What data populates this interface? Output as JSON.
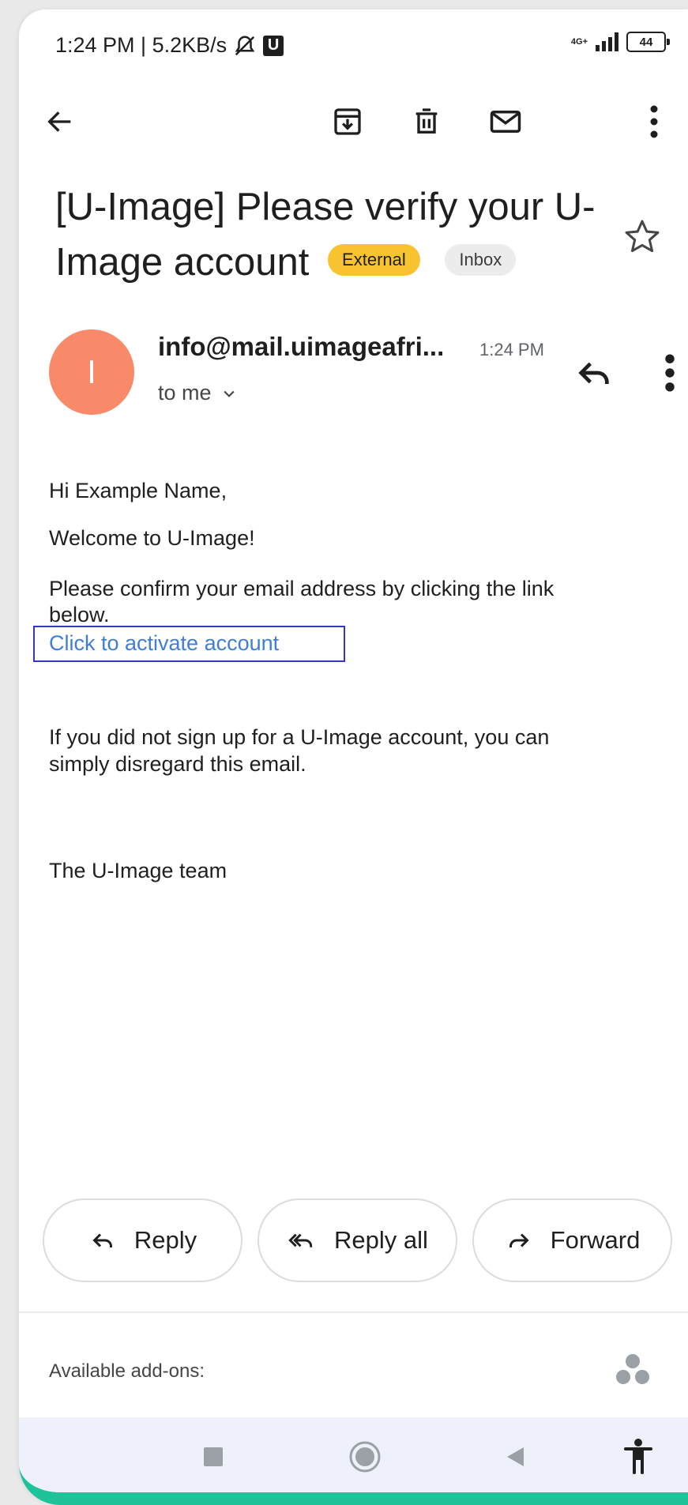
{
  "status_bar": {
    "time_speed": "1:24 PM | 5.2KB/s",
    "network": "4G+",
    "battery": "44"
  },
  "toolbar": {
    "back": "arrow-left-icon",
    "archive": "archive-icon",
    "delete": "trash-icon",
    "mark_unread": "mail-icon",
    "more": "more-vertical-icon"
  },
  "email": {
    "subject": "[U-Image] Please verify your U-Image account",
    "labels": [
      "External",
      "Inbox"
    ],
    "sender": "info@mail.uimageafri...",
    "sender_initial": "I",
    "time": "1:24 PM",
    "recipient": "to me",
    "body": {
      "greeting": "Hi Example Name,",
      "welcome": "Welcome to U-Image!",
      "instruction_line1": "Please confirm your email address by clicking the link",
      "instruction_line2": "below.",
      "link_text": "Click to activate account",
      "disclaimer_line1": "If you did not sign up for a U-Image account, you can",
      "disclaimer_line2": "simply disregard this email.",
      "signature": "The U-Image team"
    }
  },
  "actions": {
    "reply": "Reply",
    "reply_all": "Reply all",
    "forward": "Forward"
  },
  "addons": {
    "label": "Available add-ons:"
  },
  "colors": {
    "avatar": "#f88a6a",
    "external_badge": "#f7c32e",
    "link": "#3f7dd8",
    "frame_accent": "#1ec39a"
  }
}
